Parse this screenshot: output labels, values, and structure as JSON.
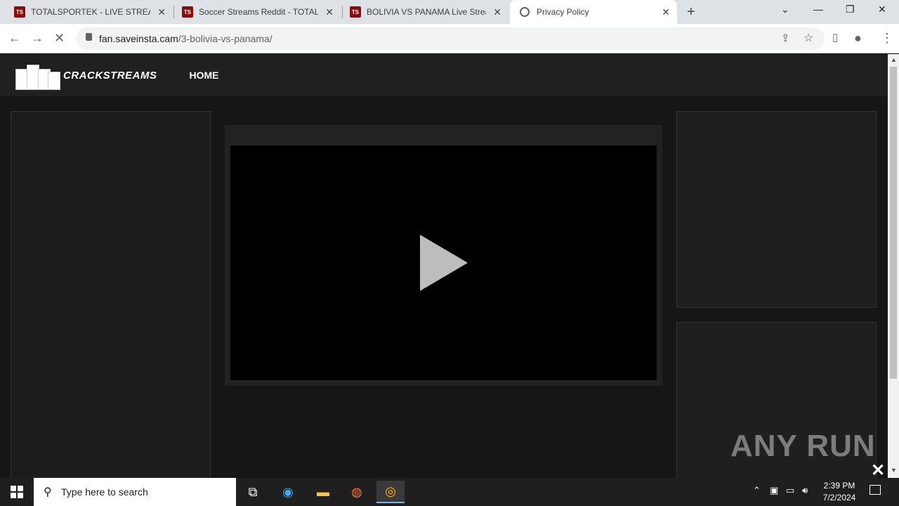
{
  "browser": {
    "tabs": [
      {
        "title": "TOTALSPORTEK - LIVE STREAMS",
        "favicon": "TS"
      },
      {
        "title": "Soccer Streams Reddit - TOTALSP",
        "favicon": "TS"
      },
      {
        "title": "BOLIVIA VS PANAMA Live Stream",
        "favicon": "TS"
      },
      {
        "title": "Privacy Policy",
        "favicon": "globe-icon"
      }
    ],
    "url_domain": "fan.saveinsta.cam",
    "url_path": "/3-bolivia-vs-panama/"
  },
  "site": {
    "logo_text": "CRACKSTREAMS",
    "nav_home": "HOME"
  },
  "watermark": "ANY RUN",
  "taskbar": {
    "search_placeholder": "Type here to search",
    "time": "2:39 PM",
    "date": "7/2/2024"
  }
}
